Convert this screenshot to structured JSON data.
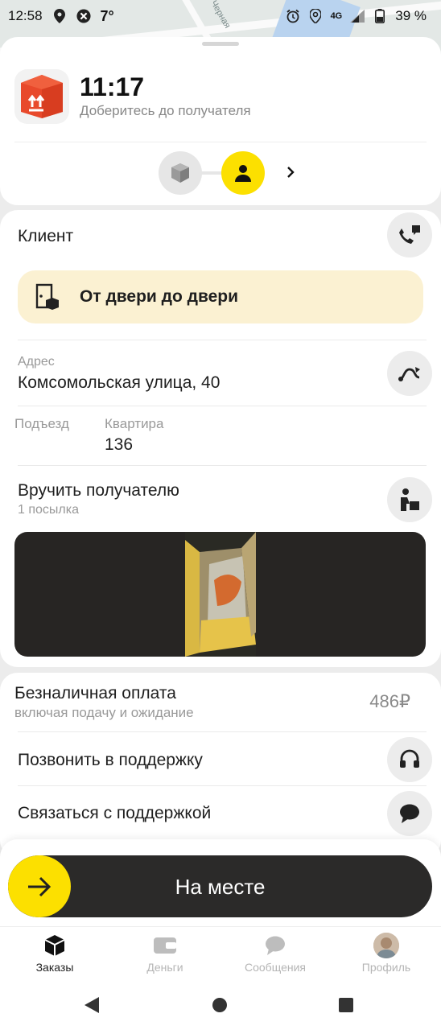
{
  "status_bar": {
    "time": "12:58",
    "temperature": "7°",
    "network": "4G",
    "battery": "39 %"
  },
  "map": {
    "street_label": "Черная"
  },
  "order": {
    "eta": "11:17",
    "subtitle": "Доберитесь до получателя"
  },
  "client": {
    "title": "Клиент",
    "delivery_type": "От двери до двери",
    "address_label": "Адрес",
    "address": "Комсомольская улица, 40",
    "entrance_label": "Подъезд",
    "flat_label": "Квартира",
    "flat": "136",
    "handover_title": "Вручить получателю",
    "handover_sub": "1 посылка"
  },
  "payment": {
    "title": "Безналичная оплата",
    "subtitle": "включая подачу и ожидание",
    "price": "486₽"
  },
  "support": {
    "call": "Позвонить в поддержку",
    "contact": "Связаться с поддержкой"
  },
  "action": {
    "label": "На месте"
  },
  "tabs": [
    {
      "label": "Заказы",
      "icon": "box-icon",
      "active": true
    },
    {
      "label": "Деньги",
      "icon": "wallet-icon",
      "active": false
    },
    {
      "label": "Сообщения",
      "icon": "chat-icon",
      "active": false
    },
    {
      "label": "Профиль",
      "icon": "avatar",
      "active": false
    }
  ],
  "colors": {
    "accent": "#fce000",
    "door_bg": "#fbf1d2",
    "button_dark": "#2b2a29",
    "order_icon": "#e8492b"
  }
}
